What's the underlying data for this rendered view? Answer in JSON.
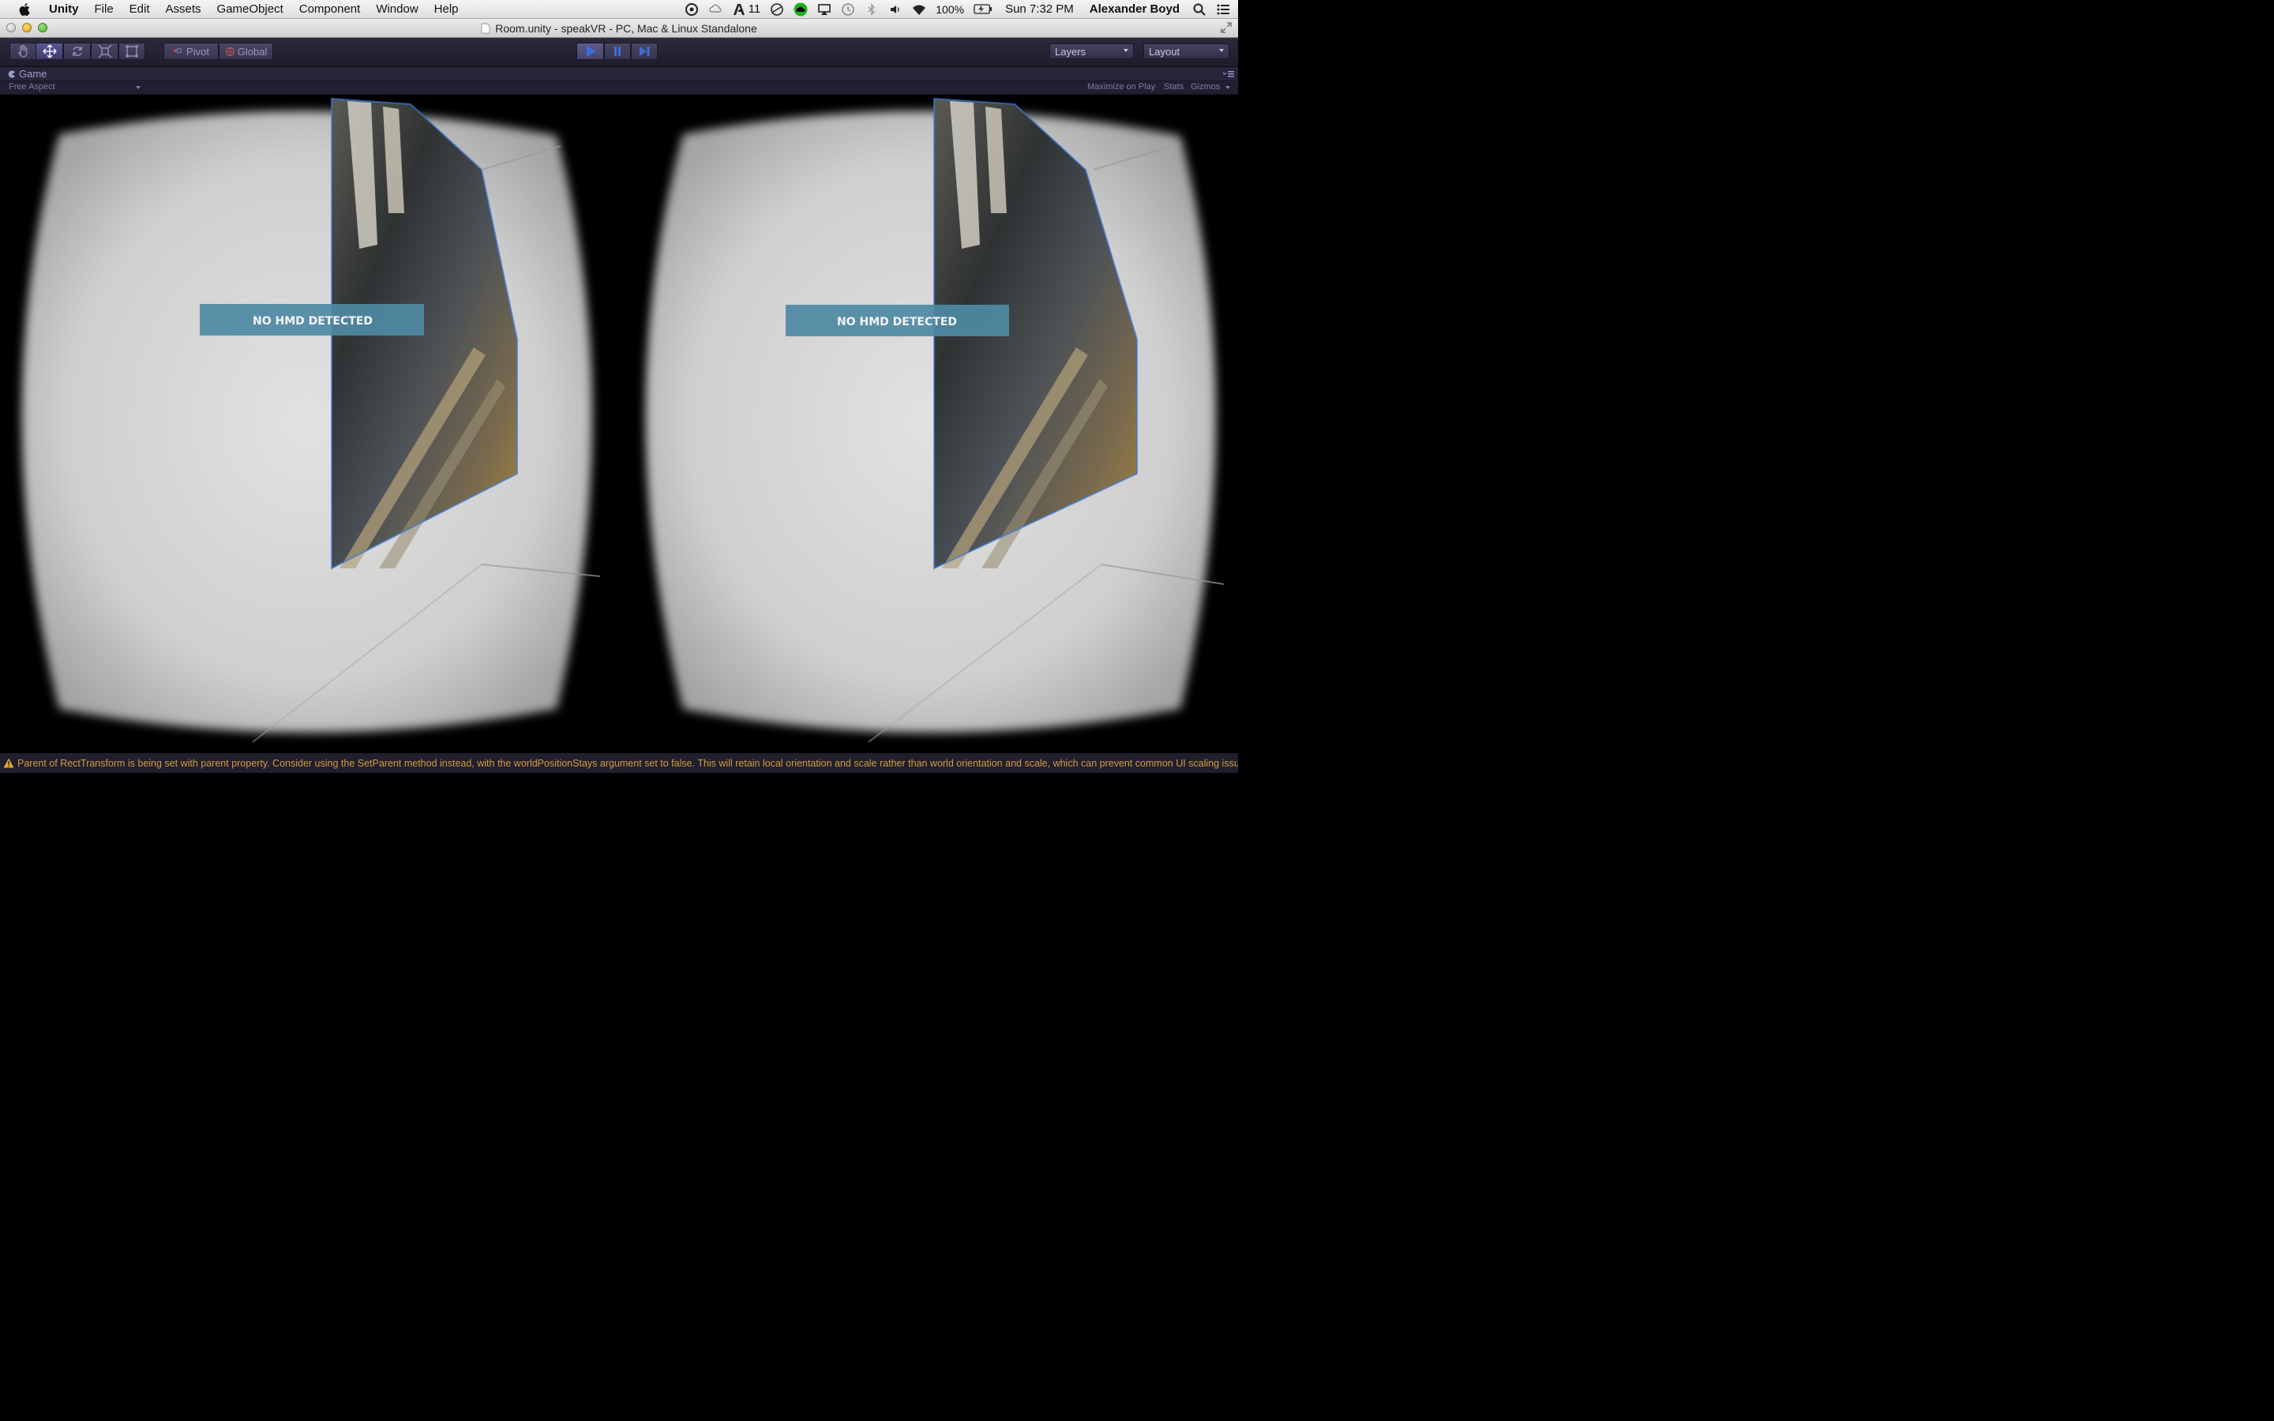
{
  "menubar": {
    "app": "Unity",
    "items": [
      "File",
      "Edit",
      "Assets",
      "GameObject",
      "Component",
      "Window",
      "Help"
    ],
    "status": {
      "adobe_count": "11",
      "battery": "100%",
      "clock": "Sun 7:32 PM",
      "user": "Alexander Boyd"
    }
  },
  "window": {
    "title": "Room.unity - speakVR - PC, Mac & Linux Standalone"
  },
  "toolbar": {
    "tools": [
      "hand-tool",
      "move-tool",
      "rotate-tool",
      "scale-tool",
      "rect-tool"
    ],
    "selected_tool": "move-tool",
    "pivot_label": "Pivot",
    "global_label": "Global",
    "layers_label": "Layers",
    "layout_label": "Layout"
  },
  "panel": {
    "tab": "Game",
    "aspect": "Free Aspect",
    "options": [
      "Maximize on Play",
      "Stats",
      "Gizmos"
    ]
  },
  "scene": {
    "left_message": "NO HMD DETECTED",
    "right_message": "NO HMD DETECTED"
  },
  "console": {
    "message": "Parent of RectTransform is being set with parent property. Consider using the SetParent method instead, with the worldPositionStays argument set to false. This will retain local orientation and scale rather than world orientation and scale, which can prevent common UI scaling issues."
  },
  "colors": {
    "toolbar_bg": "#2c2a3a",
    "accent": "#3b6fd8",
    "warning": "#d49a3e"
  }
}
